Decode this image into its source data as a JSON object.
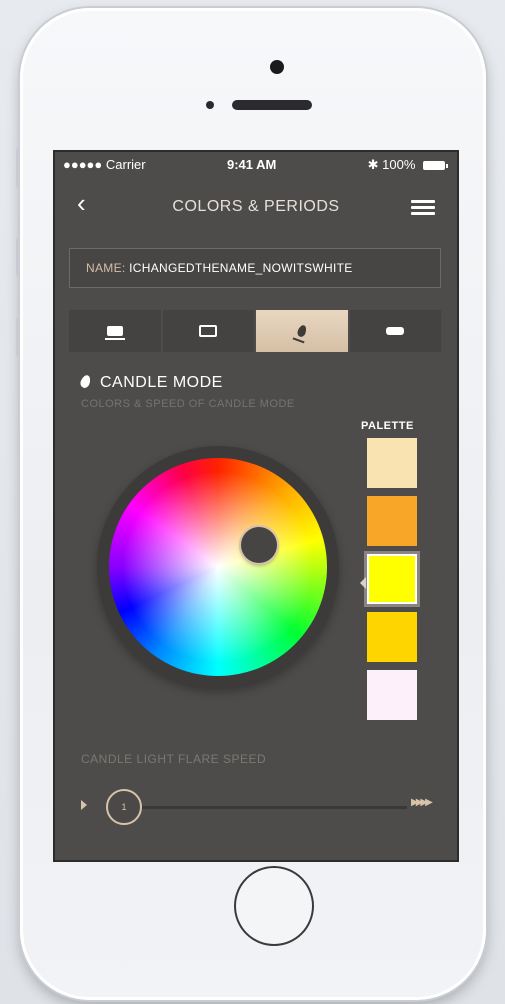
{
  "status_bar": {
    "carrier": "●●●●● Carrier",
    "time": "9:41 AM",
    "battery": "100%"
  },
  "navbar": {
    "back_icon": "chevron-left-icon",
    "title": "COLORS & PERIODS",
    "menu_icon": "hamburger-icon"
  },
  "name_field": {
    "label": "NAME: ",
    "value": "ICHANGEDTHENAME_NOWITSWHITE"
  },
  "tabs": [
    {
      "icon": "cup-icon",
      "active": false
    },
    {
      "icon": "frame-icon",
      "active": false
    },
    {
      "icon": "flame-icon",
      "active": true
    },
    {
      "icon": "bar-icon",
      "active": false
    }
  ],
  "section": {
    "title": "CANDLE MODE",
    "subtitle": "COLORS & SPEED OF CANDLE MODE"
  },
  "palette": {
    "label": "PALETTE",
    "swatches": [
      "#f9e3b0",
      "#f7a628",
      "#ffff00",
      "#ffd500",
      "#fdf0fb"
    ],
    "selected_index": 2
  },
  "color_wheel": {
    "selected_color": "#ffff00"
  },
  "speed": {
    "label": "CANDLE LIGHT FLARE SPEED",
    "value": "1",
    "slow_icon": "play-icon",
    "fast_icon": "fast-forward-icon"
  },
  "colors": {
    "screen_bg": "#4e4c4b",
    "accent": "#d7c3a9"
  }
}
